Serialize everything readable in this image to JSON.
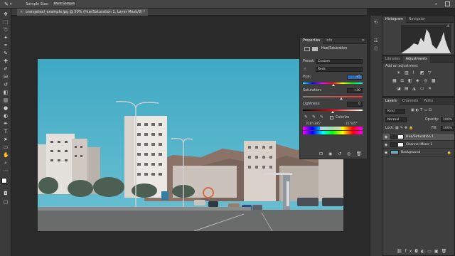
{
  "options_bar": {
    "sample_size_label": "Sample Size:",
    "sample_size_value": "Point Sample"
  },
  "document": {
    "tab_title": "orangeteal_example.jpg @ 50% (Hue/Saturation 1, Layer Mask/8) *"
  },
  "properties": {
    "tabs": [
      "Properties",
      "Info"
    ],
    "adjustment_name": "Hue/Saturation",
    "preset_label": "Preset:",
    "preset_value": "Custom",
    "channel_value": "Reds",
    "hue_label": "Hue:",
    "hue_value": "+5",
    "saturation_label": "Saturation:",
    "saturation_value": "+30",
    "lightness_label": "Lightness:",
    "lightness_value": "0",
    "colorize_label": "Colorize",
    "range_left": "318°/345°",
    "range_right": "15°\\45°"
  },
  "histogram": {
    "tabs": [
      "Histogram",
      "Navigator"
    ]
  },
  "adjustments": {
    "tabs": [
      "Libraries",
      "Adjustments"
    ],
    "add_label": "Add an adjustment"
  },
  "layers": {
    "tabs": [
      "Layers",
      "Channels",
      "Paths"
    ],
    "filter_value": "Kind",
    "blend_mode": "Normal",
    "opacity_label": "Opacity:",
    "opacity_value": "100%",
    "lock_label": "Lock:",
    "fill_label": "Fill:",
    "fill_value": "100%",
    "items": [
      {
        "name": "Hue/Saturation 1"
      },
      {
        "name": "Channel Mixer 1"
      },
      {
        "name": "Background"
      }
    ]
  },
  "colors": {
    "sky": "#4fb1c8",
    "panel": "#3f3f3f",
    "accent": "#2f6ab6"
  }
}
